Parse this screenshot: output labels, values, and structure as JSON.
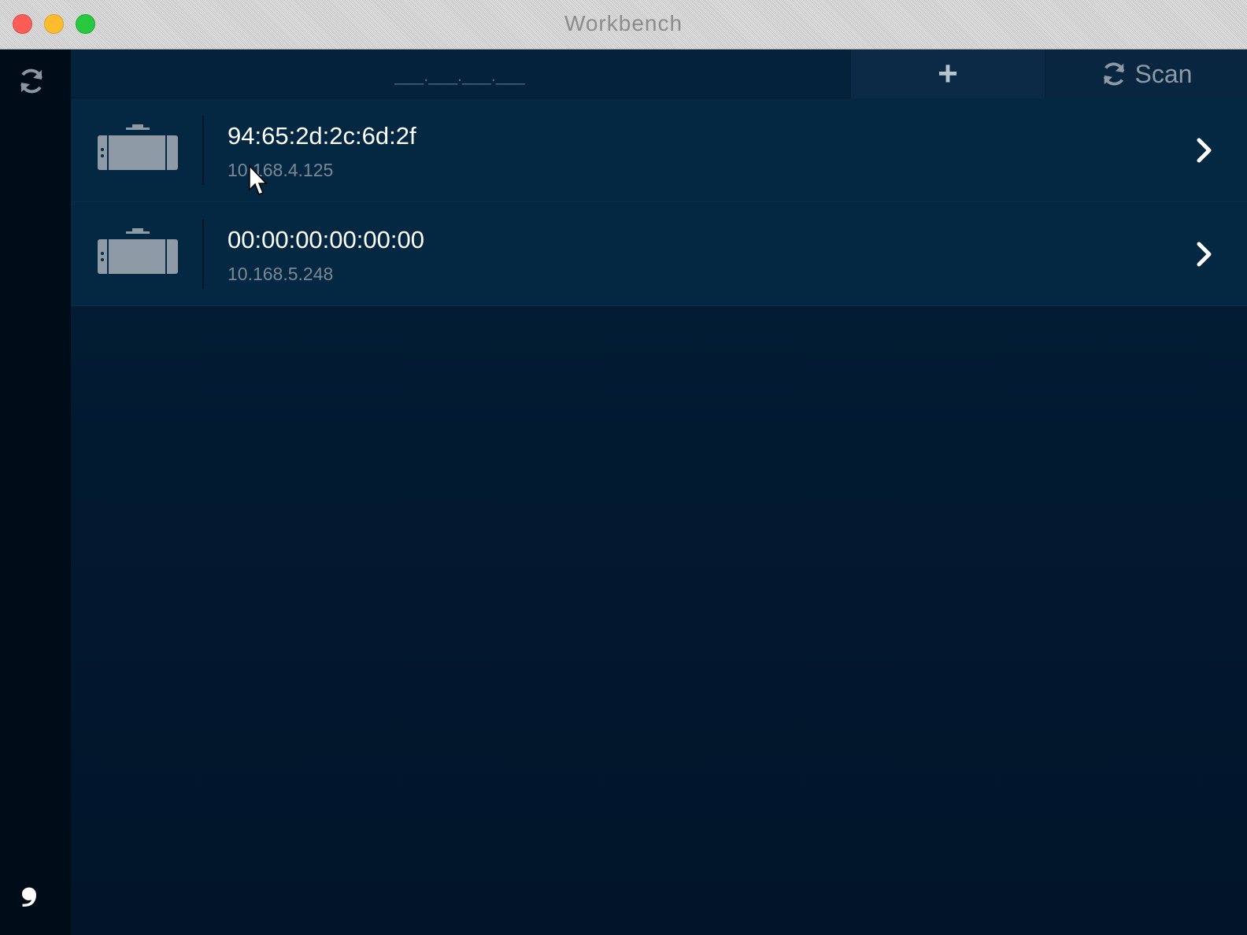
{
  "window": {
    "title": "Workbench"
  },
  "sidebar": {
    "refresh_icon": "refresh-icon",
    "logo_glyph": "❟"
  },
  "header": {
    "ip_placeholder": "___.___.___.___",
    "add_label": "+",
    "scan_label": "Scan",
    "scan_icon": "refresh-icon"
  },
  "devices": [
    {
      "mac": "94:65:2d:2c:6d:2f",
      "ip": "10.168.4.125",
      "icon": "device-icon"
    },
    {
      "mac": "00:00:00:00:00:00",
      "ip": "10.168.5.248",
      "icon": "device-icon"
    }
  ],
  "colors": {
    "background": "#011426",
    "row": "#052842",
    "header": "#03223c",
    "sidebar": "#000c18"
  }
}
